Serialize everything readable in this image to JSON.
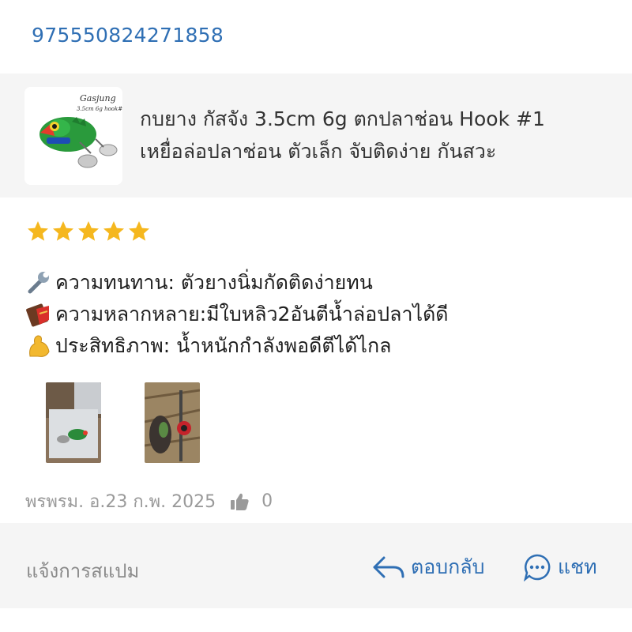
{
  "order": {
    "id": "975550824271858"
  },
  "product": {
    "title_line1": "กบยาง กัสจัง 3.5cm 6g ตกปลาช่อน Hook #1",
    "title_line2": "เหยื่อล่อปลาช่อน ตัวเล็ก จับติดง่าย กันสวะ",
    "thumb_caption_1": "Gasjung",
    "thumb_caption_2": "3.5cm 6g hook#1"
  },
  "review": {
    "rating": 5,
    "rating_max": 5,
    "star_color": "#f5b71e",
    "lines": [
      {
        "icon": "wrench-icon",
        "text": "ความทนทาน:  ตัวยางนิ่มกัดติดง่ายทน"
      },
      {
        "icon": "chocolate-bar-icon",
        "text": "ความหลากหลาย:มีใบหลิว2อันตีน้ำล่อปลาได้ดี"
      },
      {
        "icon": "flexed-biceps-icon",
        "text": "ประสิทธิภาพ: น้ำหนักกำลังพอดีตีได้ไกล"
      }
    ],
    "photos": [
      "review-photo-1",
      "review-photo-2"
    ]
  },
  "meta": {
    "date": "พรพรม. อ.23 ก.พ. 2025",
    "like_count": "0"
  },
  "footer": {
    "report_label": "แจ้งการสแปม",
    "reply_label": "ตอบกลับ",
    "chat_label": "แชท"
  },
  "colors": {
    "accent": "#2f6fb4",
    "muted": "#9a9a9a",
    "panel": "#f5f5f5"
  }
}
